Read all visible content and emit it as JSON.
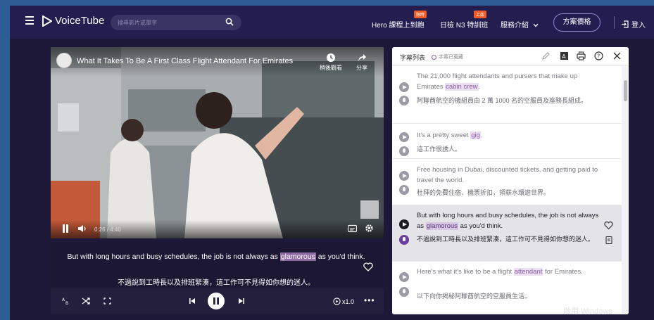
{
  "header": {
    "logo_text": "VoiceTube",
    "search_placeholder": "搜尋影片或單字",
    "nav": [
      {
        "label": "Hero 課程上到飽",
        "badge": "限時"
      },
      {
        "label": "日檢 N3 特訓班",
        "badge": "上架"
      },
      {
        "label": "服務介紹"
      }
    ],
    "plan_button": "方案價格",
    "login": "登入"
  },
  "video": {
    "title": "What It Takes To Be A First Class Flight Attendant For Emirates",
    "watch_later": "稍後觀看",
    "share": "分享",
    "time": "0:26 / 4:40"
  },
  "caption": {
    "en_before": "But with long hours and busy schedules, the job is not always as ",
    "en_highlight": "glamorous",
    "en_after": " as you'd think.",
    "zh": "不過說到工時長以及排班緊湊，這工作可不見得如你想的迷人。"
  },
  "player": {
    "speed": "x1.0",
    "more": "•••"
  },
  "panel": {
    "title": "字幕列表",
    "saved": "字幕已蒐藏",
    "items": [
      {
        "en_before": "The 21,000 flight attendants and pursers that make up Emirates ",
        "en_kw": "cabin crew",
        "en_after": ".",
        "zh": "阿聯酋航空的機組員由 2 萬 1000 名的空服員及座務長組成。"
      },
      {
        "en_before": "It's a pretty sweet ",
        "en_kw": "gig",
        "en_after": ".",
        "zh": "這工作很誘人。"
      },
      {
        "en_before": "Free housing in Dubai, discounted tickets, and getting paid to travel the world.",
        "en_kw": "",
        "en_after": "",
        "zh": "杜拜的免費住宿、機票折扣，領薪水環遊世界。"
      },
      {
        "en_before": "But with long hours and busy schedules, the job is not always as ",
        "en_kw": "glamorous",
        "en_after": " as you'd think.",
        "zh": "不過說到工時長以及排班緊湊，這工作可不見得如你想的迷人。"
      },
      {
        "en_before": "Here's what it's like to be a flight ",
        "en_kw": "attendant",
        "en_after": " for Emirates.",
        "zh": "以下向你揭秘阿聯酋航空的空服員生活。"
      }
    ]
  },
  "os_watermark": "啟用 Windows",
  "colors": {
    "topbar": "#241d4f",
    "background": "#1d1838",
    "highlight": "#8f6aa3",
    "active_mic": "#6b3fa0"
  }
}
